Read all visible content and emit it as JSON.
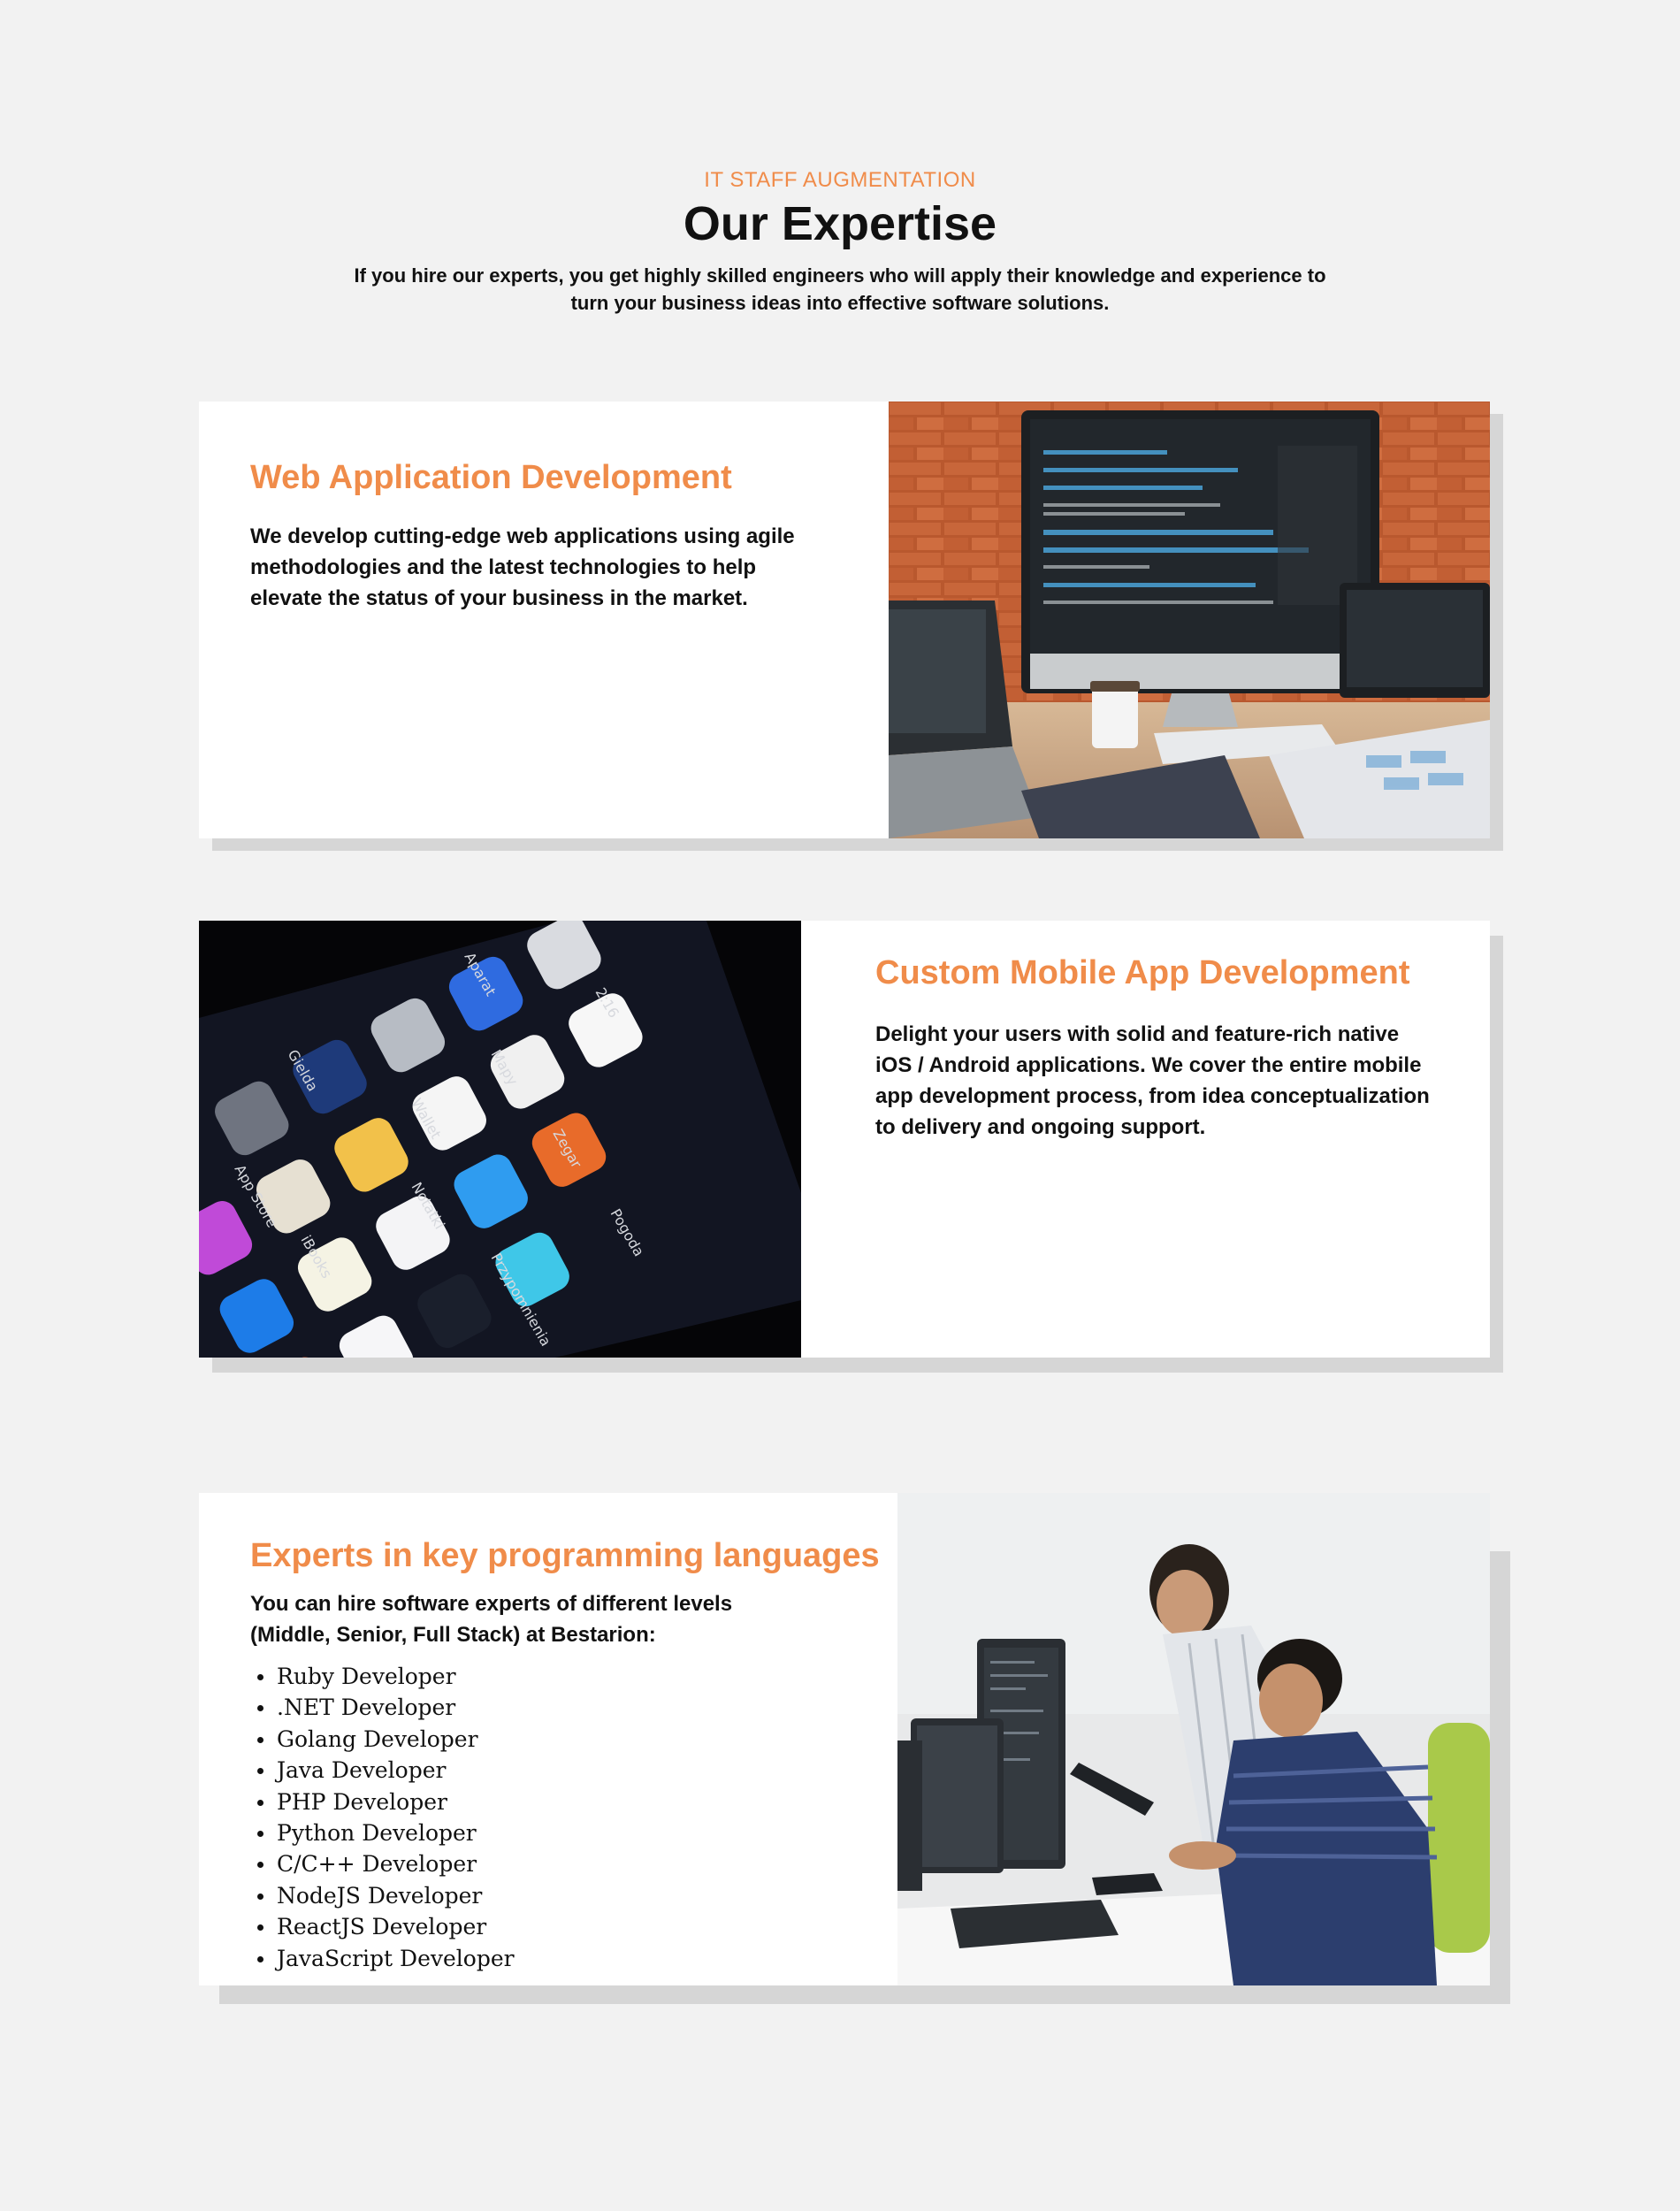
{
  "header": {
    "eyebrow": "IT STAFF AUGMENTATION",
    "title": "Our Expertise",
    "intro": "If you hire our experts, you get highly skilled engineers who will apply their knowledge and experience to turn your business ideas into effective software solutions."
  },
  "cards": [
    {
      "title": "Web Application Development",
      "text": "We develop cutting-edge web applications using agile methodologies and the latest technologies to help elevate the status of your business in the market."
    },
    {
      "title": "Custom Mobile App Development",
      "text": "Delight your users with solid and feature-rich native iOS / Android applications. We cover the entire mobile app development process, from idea conceptualization to delivery and ongoing support."
    },
    {
      "title": "Experts in key programming languages",
      "text": "You can hire software experts of different levels (Middle, Senior, Full Stack) at Bestarion:",
      "languages": [
        "Ruby Developer",
        ".NET Developer",
        "Golang Developer",
        "Java Developer",
        "PHP Developer",
        "Python Developer",
        "C/C++ Developer",
        "NodeJS Developer",
        "ReactJS Developer",
        "JavaScript Developer"
      ]
    }
  ],
  "phone_apps": [
    "Gielda",
    "Aparat",
    "Mail",
    "Kontakty",
    "Mapy",
    "Wallet",
    "Zegar",
    "Kalendarz",
    "Zdjęcia",
    "Notatki",
    "Pogoda",
    "App Store",
    "iBooks",
    "Przypomnienia",
    "Store"
  ],
  "calendar_icon": {
    "day": "29",
    "label": "środa"
  },
  "colors": {
    "accent": "#f08c4a",
    "background": "#f2f2f2",
    "card": "#ffffff",
    "shadow": "#d6d6d6"
  }
}
